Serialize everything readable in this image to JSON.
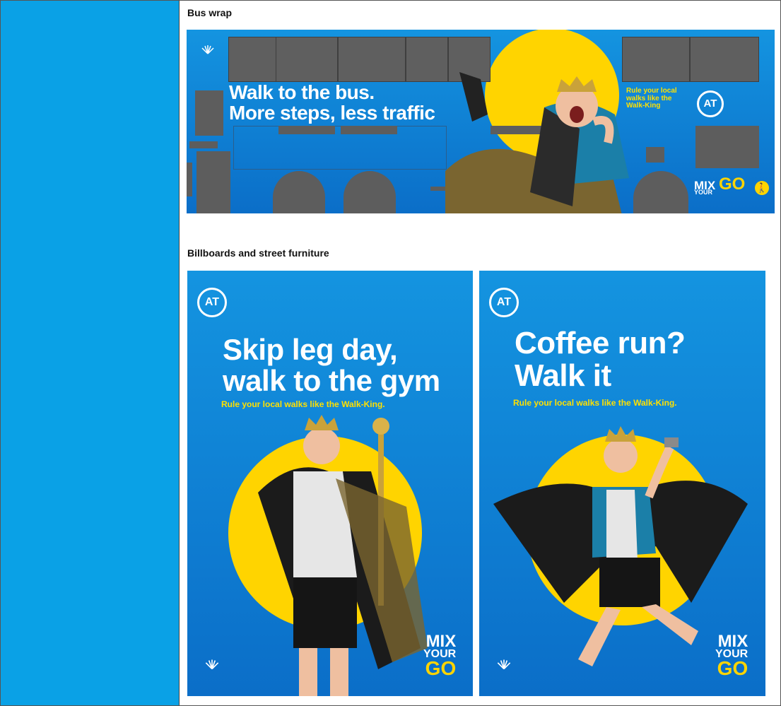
{
  "sections": {
    "bus_heading": "Bus wrap",
    "billboards_heading": "Billboards and street furniture"
  },
  "bus": {
    "headline_1": "Walk to the bus.",
    "headline_2": "More steps, less traffic",
    "tagline_1": "Rule your local",
    "tagline_2": "walks like the",
    "tagline_3": "Walk-King",
    "at_logo": "AT",
    "mix_1": "MIX",
    "mix_2": "YOUR",
    "mix_3": "GO"
  },
  "billboard1": {
    "at_logo": "AT",
    "headline_1": "Skip leg day,",
    "headline_2": "walk to the gym",
    "tagline": "Rule your local walks like the Walk-King.",
    "mix_1": "MIX",
    "mix_2": "YOUR",
    "mix_3": "GO"
  },
  "billboard2": {
    "at_logo": "AT",
    "headline_1": "Coffee run?",
    "headline_2": "Walk it",
    "tagline": "Rule your local walks like the Walk-King.",
    "mix_1": "MIX",
    "mix_2": "YOUR",
    "mix_3": "GO"
  },
  "colors": {
    "sidebar": "#0aa1e6",
    "ad_blue": "#1494e0",
    "sun_yellow": "#ffd400",
    "bus_gray": "#5d5d5d"
  },
  "icons": [
    "council-logo-icon",
    "at-logo-icon",
    "walking-person-icon"
  ]
}
